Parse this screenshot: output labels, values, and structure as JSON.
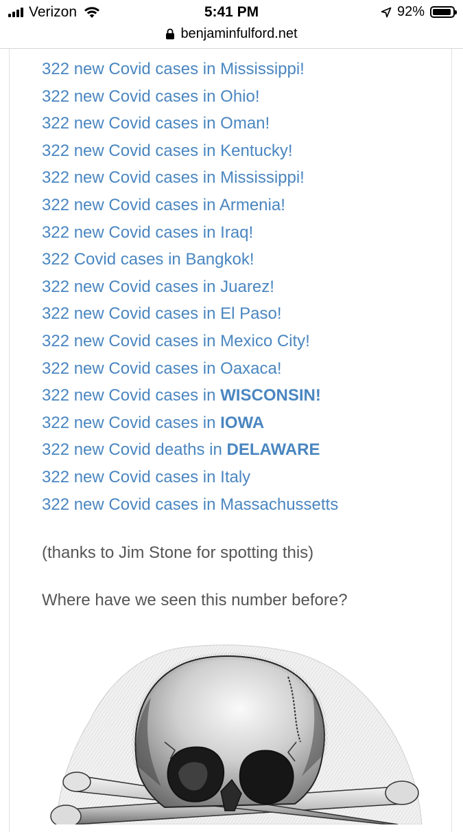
{
  "status_bar": {
    "carrier": "Verizon",
    "time": "5:41 PM",
    "battery_percent": "92%",
    "battery_level": 0.92,
    "icons": [
      "signal-bars-icon",
      "wifi-icon",
      "location-arrow-icon",
      "battery-icon"
    ]
  },
  "browser": {
    "url": "benjaminfulford.net",
    "lock_icon": "lock-icon"
  },
  "article": {
    "case_lines": [
      {
        "prefix": "322 new Covid cases in ",
        "place": "Mississippi!",
        "bold": false
      },
      {
        "prefix": "322 new Covid cases in ",
        "place": "Ohio!",
        "bold": false
      },
      {
        "prefix": "322 new Covid cases in ",
        "place": "Oman!",
        "bold": false
      },
      {
        "prefix": "322 new Covid cases in ",
        "place": "Kentucky!",
        "bold": false
      },
      {
        "prefix": "322 new Covid cases in ",
        "place": "Mississippi!",
        "bold": false
      },
      {
        "prefix": "322 new Covid cases in ",
        "place": "Armenia!",
        "bold": false
      },
      {
        "prefix": "322 new Covid cases in ",
        "place": "Iraq!",
        "bold": false
      },
      {
        "prefix": "322 Covid cases in ",
        "place": "Bangkok!",
        "bold": false
      },
      {
        "prefix": "322 new Covid cases in ",
        "place": "Juarez!",
        "bold": false
      },
      {
        "prefix": "322 new Covid cases in ",
        "place": "El Paso!",
        "bold": false
      },
      {
        "prefix": "322 new Covid cases in ",
        "place": "Mexico City!",
        "bold": false
      },
      {
        "prefix": "322 new Covid cases in ",
        "place": "Oaxaca!",
        "bold": false
      },
      {
        "prefix": "322 new Covid cases in ",
        "place": "WISCONSIN!",
        "bold": true
      },
      {
        "prefix": "322 new Covid cases in ",
        "place": "IOWA",
        "bold": true
      },
      {
        "prefix": "322 new Covid deaths in ",
        "place": "DELAWARE",
        "bold": true
      },
      {
        "prefix": "322 new Covid cases in ",
        "place": "Italy",
        "bold": false
      },
      {
        "prefix": "322 new Covid cases in ",
        "place": "Massachussetts",
        "bold": false
      }
    ],
    "thanks_text": "(thanks to Jim Stone for spotting this)",
    "question_text": "Where have we seen this number before?"
  },
  "colors": {
    "link": "#4a86c0",
    "body_text": "#555555"
  }
}
